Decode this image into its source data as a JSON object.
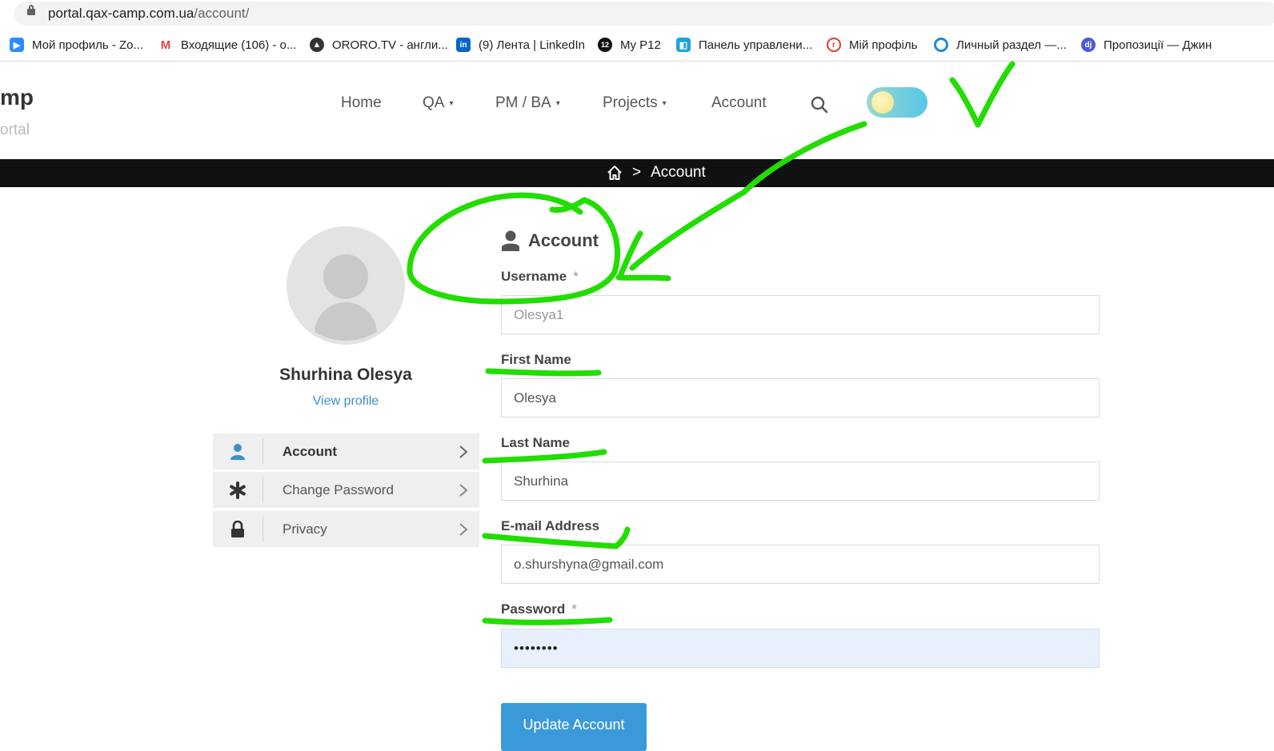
{
  "browser": {
    "url_domain": "portal.qax-camp.com.ua",
    "url_path": "/account/",
    "bookmarks": [
      {
        "label": "Мой профиль - Zo...",
        "icon": "zoom-icon",
        "color": "#2d8cff"
      },
      {
        "label": "Входящие (106) - о...",
        "icon": "gmail-icon",
        "color": "#ea4335"
      },
      {
        "label": "ORORO.TV - англи...",
        "icon": "ororo-icon",
        "color": "#333333"
      },
      {
        "label": "(9) Лента | LinkedIn",
        "icon": "linkedin-icon",
        "color": "#0a66c2"
      },
      {
        "label": "My P12",
        "icon": "p12-icon",
        "color": "#111111"
      },
      {
        "label": "Панель управлени...",
        "icon": "panel-icon",
        "color": "#1fa3e0"
      },
      {
        "label": "Мій профіль",
        "icon": "profile-r-icon",
        "color": "#e53935"
      },
      {
        "label": "Личный раздел —...",
        "icon": "circle-target-icon",
        "color": "#1e88e5"
      },
      {
        "label": "Пропозиції — Джин",
        "icon": "djinni-icon",
        "color": "#4a5ad8"
      }
    ]
  },
  "site": {
    "logo_line1": "mp",
    "logo_line2": "ortal",
    "nav": [
      {
        "label": "Home",
        "dropdown": false
      },
      {
        "label": "QA",
        "dropdown": true
      },
      {
        "label": "PM / BA",
        "dropdown": true
      },
      {
        "label": "Projects",
        "dropdown": true
      },
      {
        "label": "Account",
        "dropdown": false
      }
    ],
    "caret": "▾",
    "theme_toggle": "light"
  },
  "breadcrumb": {
    "separator": ">",
    "current": "Account"
  },
  "profile": {
    "name": "Shurhina Olesya",
    "view_profile": "View profile",
    "menu": [
      {
        "label": "Account",
        "icon": "user-icon",
        "active": true
      },
      {
        "label": "Change Password",
        "icon": "asterisk-icon",
        "active": false
      },
      {
        "label": "Privacy",
        "icon": "lock-icon",
        "active": false
      }
    ]
  },
  "form": {
    "title": "Account",
    "username_label": "Username",
    "username_value": "Olesya1",
    "first_name_label": "First Name",
    "first_name_value": "Olesya",
    "last_name_label": "Last Name",
    "last_name_value": "Shurhina",
    "email_label": "E-mail Address",
    "email_value": "o.shurshyna@gmail.com",
    "password_label": "Password",
    "password_value": "••••••••",
    "required_mark": "*",
    "submit_label": "Update Account"
  },
  "colors": {
    "accent": "#3a9ad9",
    "annotation": "#22dd00",
    "band": "#111111",
    "autofill": "#e8f0fe"
  }
}
